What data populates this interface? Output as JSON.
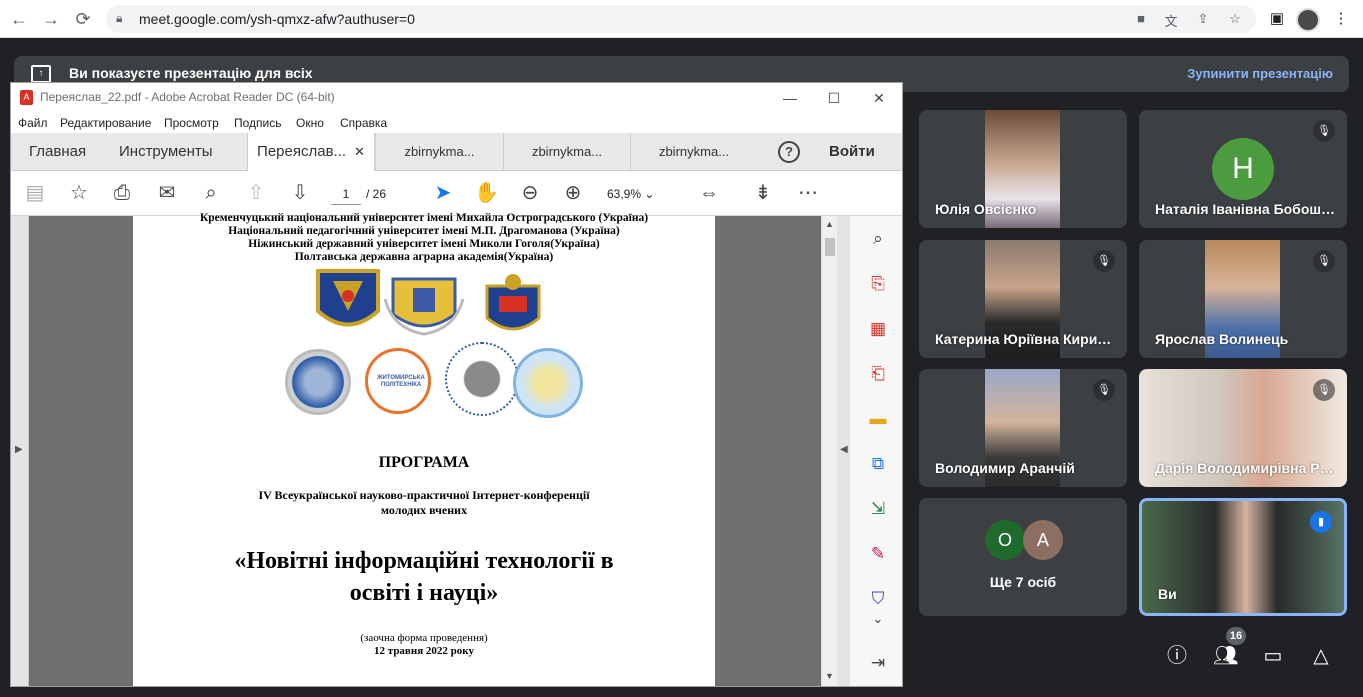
{
  "browser": {
    "url": "meet.google.com/ysh-qmxz-afw?authuser=0"
  },
  "meet": {
    "presenting_banner": "Ви показуєте презентацію для всіх",
    "stop_presenting": "Зупинити презентацію",
    "participants_badge": "16",
    "tiles": [
      {
        "name": "Юлія Овсієнко"
      },
      {
        "name": "Наталія Іванівна Бобош…",
        "avatar_letter": "Н"
      },
      {
        "name": "Катерина Юріївна Кири…"
      },
      {
        "name": "Ярослав Волинець"
      },
      {
        "name": "Володимир Аранчій"
      },
      {
        "name": "Дарія Володимирівна Р…"
      },
      {
        "name": "Ще 7 осіб",
        "avatars": [
          "О",
          "А"
        ]
      },
      {
        "name": "Ви"
      }
    ]
  },
  "acrobat": {
    "title": "Переяслав_22.pdf - Adobe Acrobat Reader DC (64-bit)",
    "menu": [
      "Файл",
      "Редактирование",
      "Просмотр",
      "Подпись",
      "Окно",
      "Справка"
    ],
    "tabs": {
      "home": "Главная",
      "tools": "Инструменты",
      "docs": [
        "Переяслав...",
        "zbirnykma...",
        "zbirnykma...",
        "zbirnykma..."
      ]
    },
    "help": "?",
    "sign_in": "Войти",
    "page_current": "1",
    "page_total": "/  26",
    "zoom": "63,9%"
  },
  "document": {
    "universities": [
      "Кременчуцький національний університет імені Михайла Остроградського (Україна)",
      "Національний педагогічний університет імені М.П. Драгоманова (Україна)",
      "Ніжинський державний університет імені Миколи Гоголя(Україна)",
      "Полтавська державна аграрна академія(Україна)"
    ],
    "program": "ПРОГРАМА",
    "conference_line1": "IV Всеукраїнської науково-практичної Інтернет-конференції",
    "conference_line2": "молодих вчених",
    "title_line1": "«Новітні інформаційні технології в",
    "title_line2": "освіті і науці»",
    "form": "(заочна форма проведення)",
    "date": "12 травня 2022 року",
    "logo_text": "ЖИТОМИРСЬКА ПОЛІТЕХНІКА"
  },
  "colors": {
    "meet_bg": "#202124",
    "tile_bg": "#3c4043",
    "accent": "#8ab4f8",
    "avatar_green": "#4b9b3f"
  }
}
